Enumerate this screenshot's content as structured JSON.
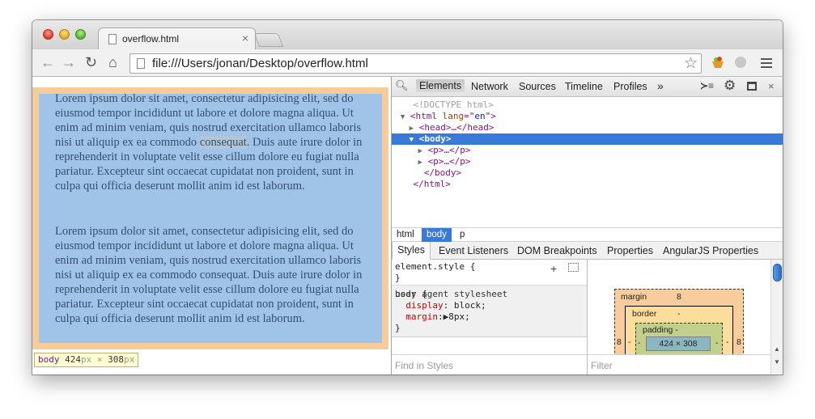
{
  "browser": {
    "tab_title": "overflow.html",
    "tab_close": "×",
    "url": "file:///Users/jonan/Desktop/overflow.html",
    "icons": [
      "back-arrow-icon",
      "forward-arrow-icon",
      "reload-icon",
      "home-icon",
      "page-icon",
      "star-icon",
      "extension-icon",
      "menu-icon"
    ]
  },
  "page": {
    "paragraph1_a": "Lorem ipsum dolor sit amet, consectetur adipisicing elit, sed do eiusmod tempor incididunt ut labore et dolore magna aliqua. Ut enim ad minim veniam, quis nostrud exercitation ullamco laboris nisi ut aliquip ex ea commodo ",
    "paragraph1_selected": "consequat",
    "paragraph1_b": ". Duis aute irure dolor in reprehenderit in voluptate velit esse cillum dolore eu fugiat nulla pariatur. Excepteur sint occaecat cupidatat non proident, sunt in culpa qui officia deserunt mollit anim id est laborum.",
    "paragraph2": "Lorem ipsum dolor sit amet, consectetur adipisicing elit, sed do eiusmod tempor incididunt ut labore et dolore magna aliqua. Ut enim ad minim veniam, quis nostrud exercitation ullamco laboris nisi ut aliquip ex ea commodo consequat. Duis aute irure dolor in reprehenderit in voluptate velit esse cillum dolore eu fugiat nulla pariatur. Excepteur sint occaecat cupidatat non proident, sunt in culpa qui officia deserunt mollit anim id est laborum.",
    "colors": {
      "margin_highlight": "#f7cc98",
      "content_highlight": "#9fc4e7"
    },
    "tooltip": {
      "tag": "body",
      "width": "424",
      "unit_w": "px",
      "times": "×",
      "height": "308",
      "unit_h": "px"
    }
  },
  "devtools": {
    "tabs": {
      "elements": "Elements",
      "network": "Network",
      "sources": "Sources",
      "timeline": "Timeline",
      "profiles": "Profiles",
      "more": "»"
    },
    "toolbar_icons": [
      "search-icon",
      "console-drawer-icon",
      "gear-icon",
      "dock-icon",
      "close-icon"
    ],
    "close": "×",
    "console_glyph": "≻≡",
    "dom": {
      "doctype": "<!DOCTYPE html>",
      "html_open_tag": "<html",
      "html_attr": "lang",
      "html_attr_val": "\"en\"",
      "html_close_bracket": ">",
      "head": "<head>…</head>",
      "body_open": "<body>",
      "p1": "<p>…</p>",
      "p2": "<p>…</p>",
      "body_close": "</body>",
      "html_close": "</html>"
    },
    "breadcrumb": [
      "html",
      "body",
      "p"
    ],
    "sidebar_tabs": [
      "Styles",
      "Event Listeners",
      "DOM Breakpoints",
      "Properties",
      "AngularJS Properties"
    ],
    "styles": {
      "element_style": "element.style {",
      "element_close": "}",
      "body_selector": "body {",
      "ua_label": "user agent stylesheet",
      "prop1_name": "display",
      "prop1_value": ": block;",
      "prop2_name": "margin",
      "prop2_value": ":▶8px;",
      "body_close": "}",
      "find_placeholder": "Find in Styles"
    },
    "metrics": {
      "margin_label": "margin",
      "margin_top": "8",
      "margin_left": "8",
      "margin_right": "8",
      "border_label": "border",
      "border_top": "-",
      "border_left": "-",
      "border_right": "-",
      "border_bottom": "-",
      "padding_label": "padding -",
      "padding_left": "-",
      "padding_right": "-",
      "padding_bottom": "-",
      "content_size": "424 × 308",
      "filter_placeholder": "Filter"
    }
  }
}
